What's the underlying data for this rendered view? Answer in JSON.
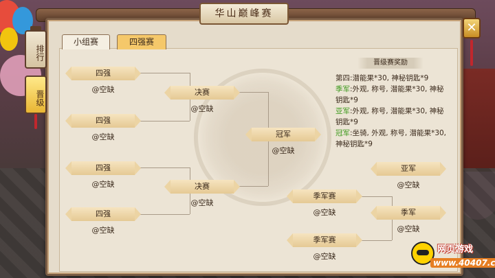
{
  "title": "华山巅峰赛",
  "side_tabs": {
    "rank": "排行",
    "advance": "晋级"
  },
  "close_label": "✕",
  "tabs": [
    {
      "label": "小组赛"
    },
    {
      "label": "四强赛"
    }
  ],
  "bracket": {
    "semis": [
      {
        "label": "四强",
        "slot": "@空缺"
      },
      {
        "label": "四强",
        "slot": "@空缺"
      },
      {
        "label": "四强",
        "slot": "@空缺"
      },
      {
        "label": "四强",
        "slot": "@空缺"
      }
    ],
    "finals": [
      {
        "label": "决赛",
        "slot": "@空缺"
      },
      {
        "label": "决赛",
        "slot": "@空缺"
      }
    ],
    "champion": {
      "label": "冠军",
      "slot": "@空缺"
    },
    "third_place": [
      {
        "label": "季军赛",
        "slot": "@空缺"
      },
      {
        "label": "季军赛",
        "slot": "@空缺"
      }
    ],
    "runner_up": {
      "label": "亚军",
      "slot": "@空缺"
    },
    "third": {
      "label": "季军",
      "slot": "@空缺"
    }
  },
  "rewards": {
    "header": "晋级赛奖励",
    "lines": [
      {
        "prefix": "第四:",
        "text": "潜能果*30, 神秘钥匙*9"
      },
      {
        "prefix": "季军",
        "text": ":外观, 称号, 潜能果*30, 神秘钥匙*9"
      },
      {
        "prefix": "亚军",
        "text": ":外观, 称号, 潜能果*30, 神秘钥匙*9"
      },
      {
        "prefix": "冠军",
        "text": ":坐骑, 外观, 称号, 潜能果*30, 神秘钥匙*9"
      }
    ]
  },
  "logo": {
    "line1": "网页游戏",
    "line2": "www.40407.com"
  },
  "colors": {
    "accent_green": "#3f9a1e",
    "tab_active": "#f5c86a",
    "panel": "#e5dccb"
  }
}
